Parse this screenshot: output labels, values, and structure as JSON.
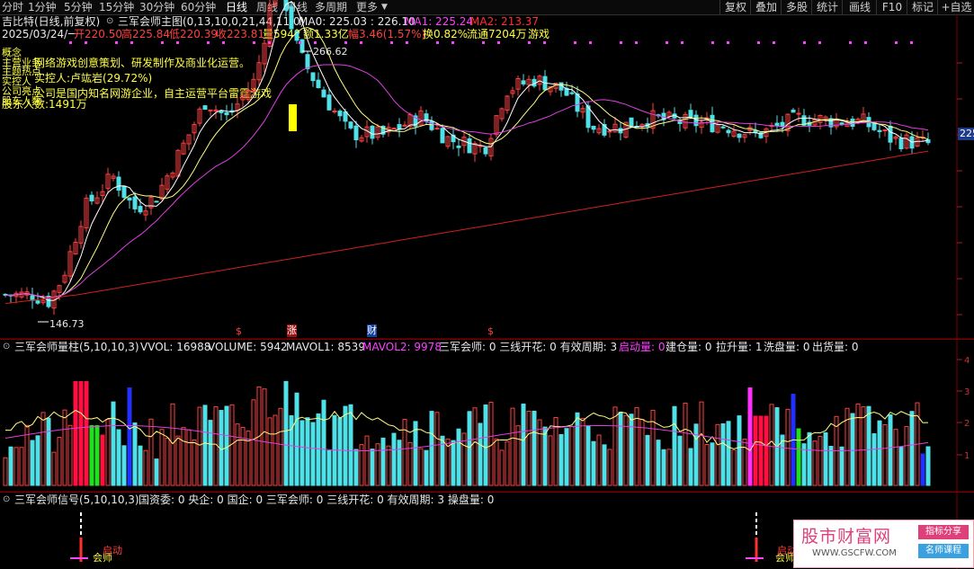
{
  "topbar": {
    "periods": [
      "分时",
      "1分钟",
      "5分钟",
      "15分钟",
      "30分钟",
      "60分钟",
      "日线",
      "周线",
      "月线",
      "多周期",
      "更多"
    ],
    "active_period": "日线",
    "right_buttons": [
      "复权",
      "叠加",
      "多股",
      "统计",
      "画线",
      "F10",
      "标记",
      "+自选"
    ]
  },
  "main_panel": {
    "stock_title": "吉比特(日线,前复权)",
    "indicator_name": "三军会师主图(0,13,10,0,21,44,11,0)",
    "ma0_label": "MA0: 225.03 : 226.10",
    "ma1_label": "MA1: 225.24",
    "ma2_label": "MA2: 213.37",
    "date": "2025/03/24/一",
    "open": "开220.50",
    "high": "高225.84",
    "low": "低220.39",
    "close": "收223.81",
    "volume": "量5942",
    "amount": "额1.33亿",
    "amplitude": "幅3.46(1.57%)",
    "turnover": "换0.82%",
    "float": "流通7204万",
    "sector": "游戏",
    "info_lines": [
      "网络游戏创意策划、研发制作及商业化运营。",
      "实控人:卢竑岩(29.72%)",
      "公司是国内知名网游企业，自主运营平台雷霆游戏",
      "股东人数:1491万"
    ],
    "overlap_labels": [
      "主营业务",
      "主题热点",
      "实控人",
      "公司亮点",
      "股东人数",
      "概念"
    ],
    "high_marker": "266.62",
    "low_marker": "146.73",
    "price_right_label": "225",
    "event_tags": [
      "$",
      "涨",
      "财",
      "$"
    ]
  },
  "volume_panel": {
    "title": "三军会师量柱(5,10,10,3)",
    "vvol": "VVOL: 16988",
    "volume": "VOLUME: 5942",
    "mavol1": "MAVOL1: 8539",
    "mavol2": "MAVOL2: 9978",
    "stats": "三军会师: 0 三线开花: 0 有效周期: 3",
    "start": "启动量: 0",
    "build": "建仓量: 0",
    "rise": "拉升量: 1",
    "wash": "洗盘量: 0",
    "out": "出货量: 0",
    "y_ticks": [
      "4",
      "3",
      "2",
      "1"
    ]
  },
  "signal_panel": {
    "title": "三军会师信号(5,10,10,3)",
    "stats": "国资委: 0 央企: 0 国企: 0 三军会师: 0 三线开花: 0 有效周期: 3 操盘量: 0",
    "signal_labels": [
      "会师",
      "启动",
      "会师",
      "启动"
    ]
  },
  "logo": {
    "main": "股市财富网",
    "url": "WWW.GSCFW.COM",
    "tag1": "指标分享",
    "tag2": "名师课程"
  },
  "colors": {
    "up": "#ff4040",
    "down": "#50e0e8",
    "ma_white": "#ffff80",
    "ma_magenta": "#e040e0",
    "ma_red": "#d02020",
    "bar_red": "#ff1040",
    "bar_green": "#20e020",
    "bar_blue": "#2030ff",
    "bar_magenta": "#ff30ff"
  }
}
